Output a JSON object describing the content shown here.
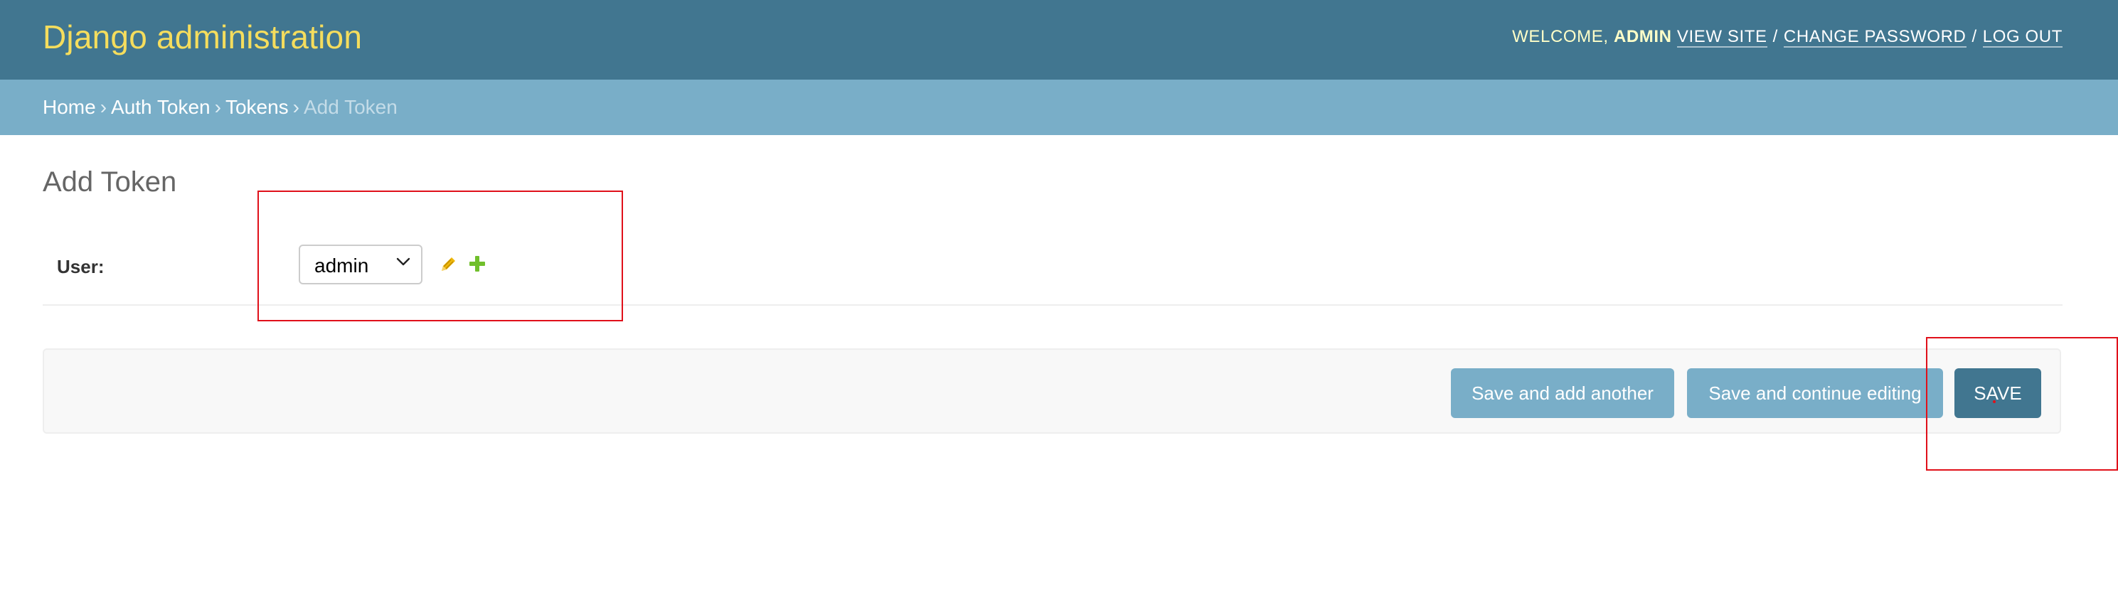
{
  "header": {
    "branding": "Django administration",
    "welcome_text": "Welcome,",
    "username": "admin",
    "links": {
      "view_site": "View site",
      "change_password": "Change password",
      "log_out": "Log out"
    },
    "separator": "/"
  },
  "breadcrumbs": {
    "items": [
      "Home",
      "Auth Token",
      "Tokens"
    ],
    "current": "Add Token",
    "arrow": "›"
  },
  "page": {
    "title": "Add Token"
  },
  "form": {
    "user_label": "User:",
    "user_value": "admin",
    "icons": {
      "edit": "pencil-icon",
      "add": "plus-icon"
    }
  },
  "submit_row": {
    "save_add_another": "Save and add another",
    "save_continue": "Save and continue editing",
    "save": "Save"
  },
  "colors": {
    "header_bg": "#417690",
    "branding": "#f5dd5d",
    "breadcrumbs_bg": "#79aec8",
    "button_light": "#79aec8",
    "button_dark": "#417690",
    "highlight": "#e0101a"
  }
}
